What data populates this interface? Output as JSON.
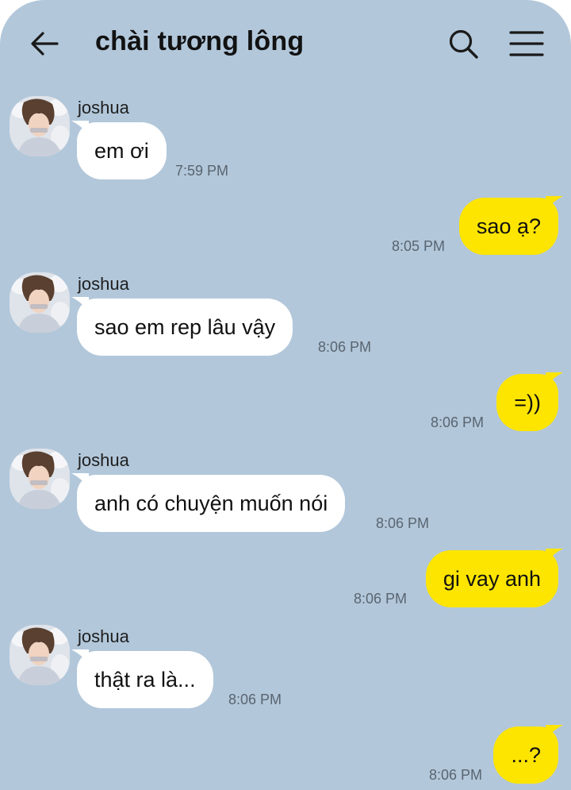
{
  "header": {
    "title": "chài tương lông",
    "back_icon": "arrow-left-icon",
    "search_icon": "search-icon",
    "menu_icon": "hamburger-menu-icon"
  },
  "colors": {
    "background": "#b2c7da",
    "incoming_bubble": "#ffffff",
    "outgoing_bubble": "#fee500"
  },
  "messages": [
    {
      "direction": "in",
      "sender": "joshua",
      "text": "em ơi",
      "time": "7:59 PM"
    },
    {
      "direction": "out",
      "text": "sao ạ?",
      "time": "8:05 PM"
    },
    {
      "direction": "in",
      "sender": "joshua",
      "text": "sao em rep lâu vậy",
      "time": "8:06 PM"
    },
    {
      "direction": "out",
      "text": "=))",
      "time": "8:06 PM"
    },
    {
      "direction": "in",
      "sender": "joshua",
      "text": "anh có chuyện muốn nói",
      "time": "8:06 PM"
    },
    {
      "direction": "out",
      "text": "gi vay anh",
      "time": "8:06 PM"
    },
    {
      "direction": "in",
      "sender": "joshua",
      "text": "thật ra là...",
      "time": "8:06 PM"
    },
    {
      "direction": "out",
      "text": "...?",
      "time": "8:06 PM"
    }
  ]
}
